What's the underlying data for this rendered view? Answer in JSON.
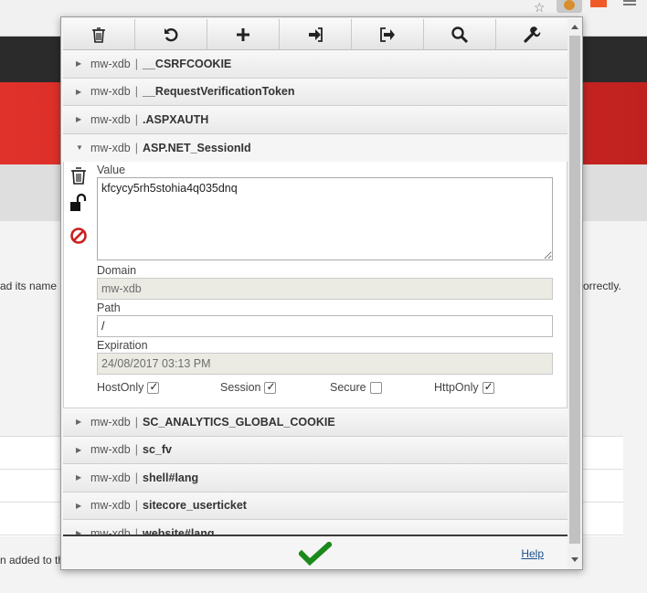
{
  "background": {
    "text_left_1": "ad its name",
    "text_right_1": "orrectly.",
    "text_left_2": "n added to th"
  },
  "toolbar": {
    "buttons": [
      {
        "icon": "trash-icon"
      },
      {
        "icon": "undo-icon"
      },
      {
        "icon": "plus-icon"
      },
      {
        "icon": "import-icon"
      },
      {
        "icon": "export-icon"
      },
      {
        "icon": "search-icon"
      },
      {
        "icon": "wrench-icon"
      }
    ]
  },
  "cookies": {
    "separator": "|",
    "before": [
      {
        "domain": "mw-xdb",
        "name": "__CSRFCOOKIE"
      },
      {
        "domain": "mw-xdb",
        "name": "__RequestVerificationToken"
      },
      {
        "domain": "mw-xdb",
        "name": ".ASPXAUTH"
      }
    ],
    "expanded": {
      "domain": "mw-xdb",
      "name": "ASP.NET_SessionId",
      "value_label": "Value",
      "value": "kfcycy5rh5stohia4q035dnq",
      "domain_label": "Domain",
      "domain_value": "mw-xdb",
      "path_label": "Path",
      "path_value": "/",
      "expiration_label": "Expiration",
      "expiration_value": "24/08/2017 03:13 PM",
      "host_only_label": "HostOnly",
      "host_only": true,
      "session_label": "Session",
      "session": true,
      "secure_label": "Secure",
      "secure": false,
      "http_only_label": "HttpOnly",
      "http_only": true
    },
    "after": [
      {
        "domain": "mw-xdb",
        "name": "SC_ANALYTICS_GLOBAL_COOKIE"
      },
      {
        "domain": "mw-xdb",
        "name": "sc_fv"
      },
      {
        "domain": "mw-xdb",
        "name": "shell#lang"
      },
      {
        "domain": "mw-xdb",
        "name": "sitecore_userticket"
      },
      {
        "domain": "mw-xdb",
        "name": "website#lang"
      }
    ]
  },
  "footer": {
    "help_label": "Help"
  },
  "colors": {
    "apply_check": "#1a8a1a",
    "block_icon": "#cc1f1f"
  }
}
